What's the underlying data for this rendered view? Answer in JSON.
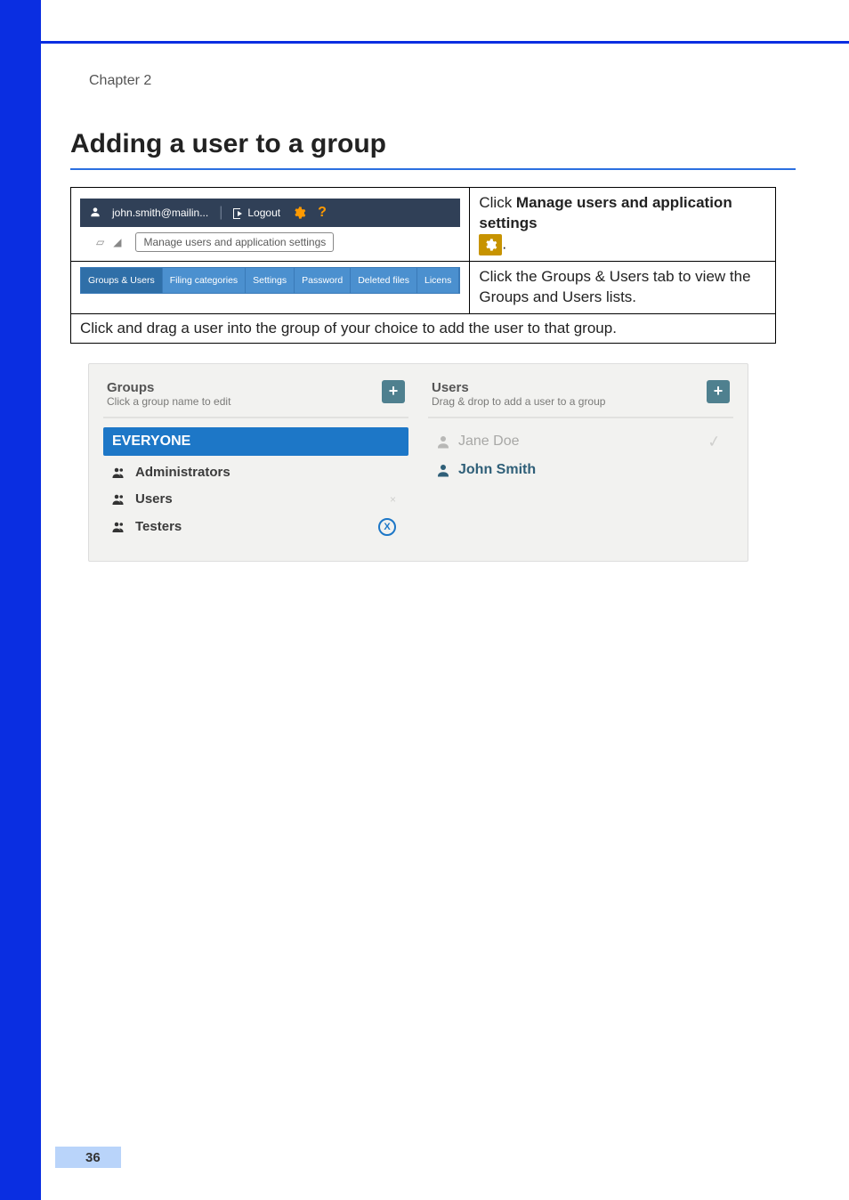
{
  "chapter_label": "Chapter 2",
  "heading": "Adding a user to a group",
  "step1": {
    "topbar": {
      "user": "john.smith@mailin...",
      "logout": "Logout"
    },
    "tooltip": "Manage users and application settings",
    "text_prefix": "Click ",
    "text_bold": "Manage users and application settings",
    "text_suffix": "."
  },
  "step2": {
    "tabs": [
      "Groups & Users",
      "Filing categories",
      "Settings",
      "Password",
      "Deleted files",
      "Licens"
    ],
    "text": "Click the Groups & Users tab to view the Groups and Users lists."
  },
  "step3_text": "Click and drag a user into the group of your choice to add the user to that group.",
  "panels": {
    "groups": {
      "title": "Groups",
      "sub": "Click a group name to edit",
      "items": [
        "EVERYONE",
        "Administrators",
        "Users",
        "Testers"
      ]
    },
    "users": {
      "title": "Users",
      "sub": "Drag & drop to add a user to a group",
      "items": [
        "Jane Doe",
        "John Smith"
      ]
    }
  },
  "page_number": "36"
}
